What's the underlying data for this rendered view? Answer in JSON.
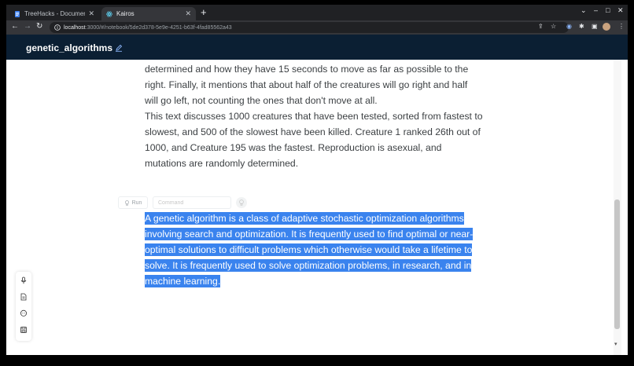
{
  "browser": {
    "tabs": [
      {
        "title": "TreeHacks - Documentos",
        "favicon": "docs-icon",
        "active": false
      },
      {
        "title": "Kairos",
        "favicon": "react-icon",
        "active": true
      }
    ],
    "new_tab": "+",
    "window_controls": {
      "chevron": "⌄",
      "minimize": "–",
      "maximize": "□",
      "close": "✕"
    },
    "url_host": "localhost",
    "url_path": ":3000/#/notebook/5de2d378-5e9e-4251-b63f-4fad85562a43"
  },
  "app": {
    "notebook_title": "genetic_algorithms"
  },
  "notebook": {
    "previous_output": "determined and how they have 15 seconds to move as far as possible to the right. Finally, it mentions that about half of the creatures will go right and half will go left, not counting the ones that don't move at all.\n This text discusses 1000 creatures that have been tested, sorted from fastest to slowest, and 500 of the slowest have been killed. Creature 1 ranked 26th out of 1000, and Creature 195 was the fastest. Reproduction is asexual, and mutations are randomly determined.",
    "run_label": "Run",
    "command_placeholder": "Command",
    "selected_cell_text": "A genetic algorithm is a class of adaptive stochastic optimization algorithms involving search and optimization. It is frequently used to find optimal or near-optimal solutions to difficult problems which otherwise would take a lifetime to solve. It is frequently used to solve optimization problems, in research, and in machine learning."
  },
  "sidebar_tools": [
    "microphone-icon",
    "document-icon",
    "chat-icon",
    "save-icon"
  ],
  "colors": {
    "header_bg": "#0b1f33",
    "selection": "#3a83ee",
    "text": "#3c4043"
  }
}
